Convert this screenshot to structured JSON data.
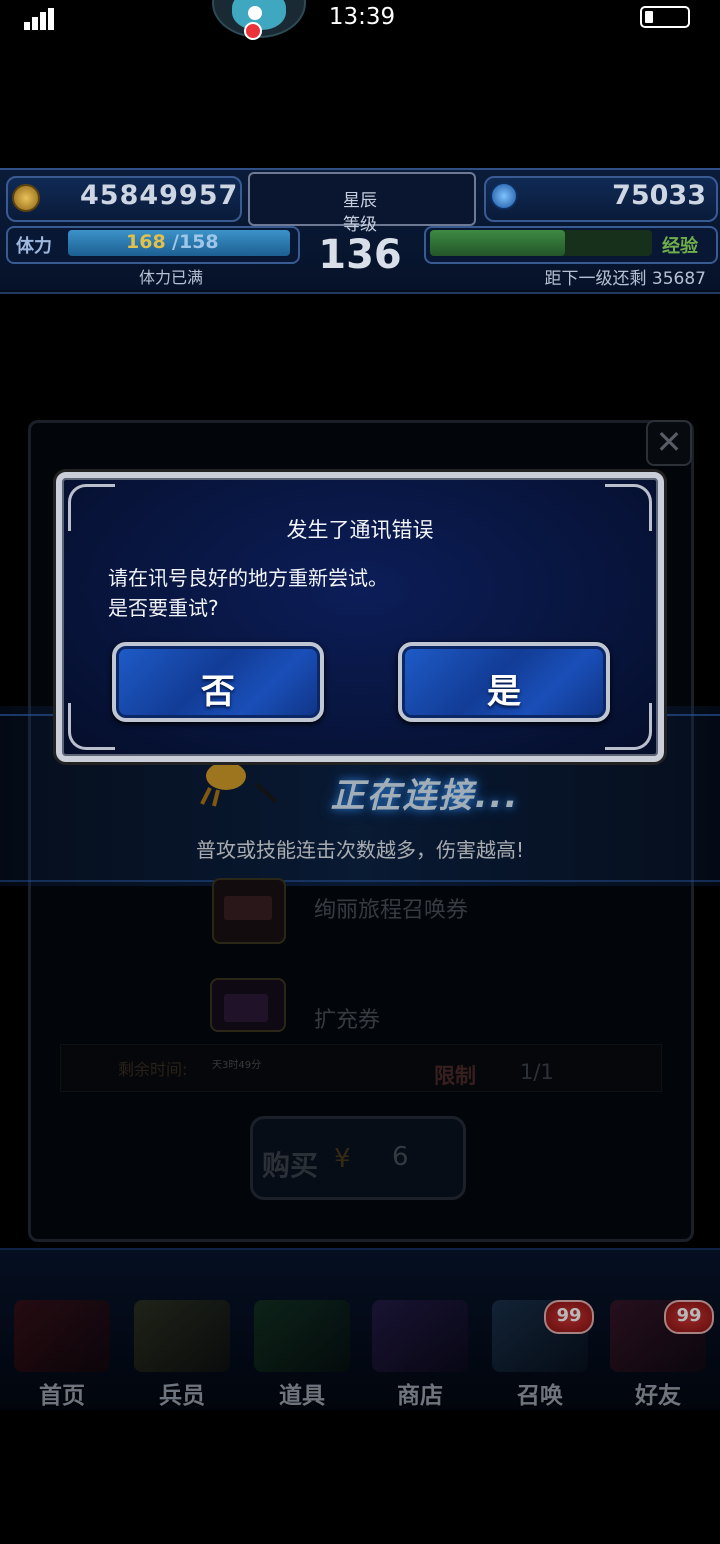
{
  "status_bar": {
    "time": "13:39"
  },
  "resources": {
    "gil": "45849957",
    "gems": "75033",
    "rank_label_line1": "星辰",
    "rank_label_line2": "等级",
    "rank": "136",
    "stamina_label": "体力",
    "stamina_current": "168",
    "stamina_max": "/158",
    "stamina_status": "体力已满",
    "exp_label": "经验",
    "exp_progress": 0.61,
    "exp_next": "距下一级还剩 35687"
  },
  "background": {
    "connecting_text": "正在连接...",
    "tip_text": "普攻或技能连击次数越多，伤害越高!",
    "items": [
      {
        "name": "绚丽旅程召唤券"
      },
      {
        "name": "扩充券"
      }
    ],
    "remaining_label": "剩余时间:",
    "remaining_value": "天3时49分",
    "limit_label": "限制",
    "limit_value": "1/1",
    "buy_label": "购买",
    "buy_currency": "¥",
    "buy_price": "6",
    "close_glyph": "✕"
  },
  "dialog": {
    "title": "发生了通讯错误",
    "message_line1": "请在讯号良好的地方重新尝试。",
    "message_line2": "是否要重试?",
    "no_label": "否",
    "yes_label": "是"
  },
  "nav": {
    "items": [
      {
        "label": "首页"
      },
      {
        "label": "兵员"
      },
      {
        "label": "道具"
      },
      {
        "label": "商店"
      },
      {
        "label": "召唤",
        "badge": "99"
      },
      {
        "label": "好友",
        "badge": "99"
      }
    ]
  },
  "colors": {
    "accent_blue": "#1f5cc9",
    "stamina_value": "#e3c04a",
    "exp_green": "#3e8a43",
    "badge_red": "#d43838"
  }
}
